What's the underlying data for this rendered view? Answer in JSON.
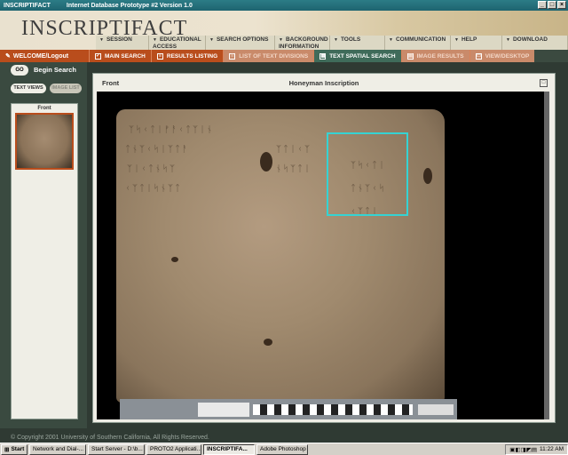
{
  "window": {
    "app_title": "INSCRIPTIFACT",
    "subtitle": "Internet Database Prototype #2 Version 1.0",
    "controls": [
      "_",
      "□",
      "×"
    ]
  },
  "header": {
    "logo": "INSCRIPTIFACT",
    "nav": [
      {
        "label": "SESSION"
      },
      {
        "label": "EDUCATIONAL ACCESS"
      },
      {
        "label": "SEARCH OPTIONS"
      },
      {
        "label": "BACKGROUND INFORMATION"
      },
      {
        "label": "TOOLS"
      },
      {
        "label": "COMMUNICATION"
      },
      {
        "label": "HELP"
      },
      {
        "label": "DOWNLOAD"
      }
    ]
  },
  "bar": {
    "welcome": "WELCOME/Logout",
    "tabs": [
      {
        "label": "MAIN SEARCH",
        "state": "normal"
      },
      {
        "label": "RESULTS LISTING",
        "state": "normal"
      },
      {
        "label": "LIST OF TEXT DIVISIONS",
        "state": "dim"
      },
      {
        "label": "TEXT SPATIAL SEARCH",
        "state": "active"
      },
      {
        "label": "IMAGE RESULTS",
        "state": "dim"
      },
      {
        "label": "VIEW/DESKTOP",
        "state": "dim"
      }
    ]
  },
  "left": {
    "go": "GO",
    "begin": "Begin Search",
    "text_views": "TEXT VIEWS",
    "image_list": "IMAGE LIST",
    "thumb_label": "Front"
  },
  "main": {
    "panel_label": "Front",
    "panel_title": "Honeyman Inscription"
  },
  "footer": {
    "copyright": "© Copyright 2001 University of Southern California, All Rights Reserved."
  },
  "taskbar": {
    "start": "Start",
    "tasks": [
      {
        "label": "Network and Dial-..."
      },
      {
        "label": "Start Server - D:\\b..."
      },
      {
        "label": "PROTO2 Applicati..."
      },
      {
        "label": "INSCRIPTIFA...",
        "active": true
      },
      {
        "label": "Adobe Photoshop"
      }
    ],
    "time": "11:22 AM"
  }
}
